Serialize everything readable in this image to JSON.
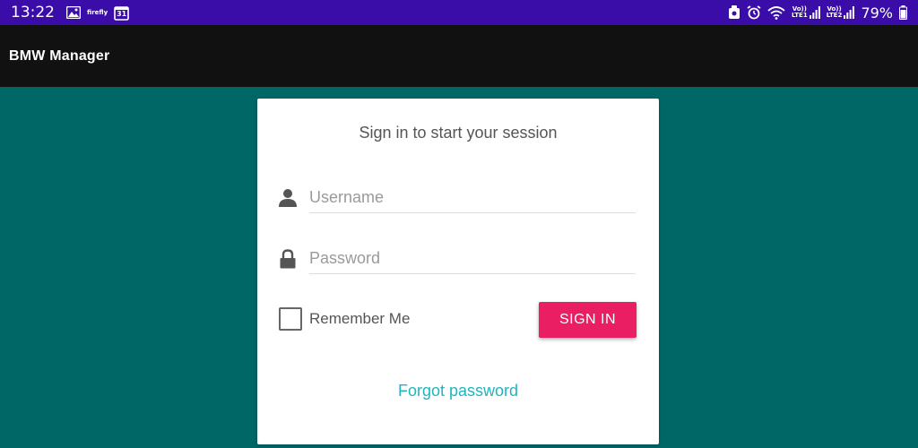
{
  "status_bar": {
    "time": "13:22",
    "left_icons": [
      "image-icon",
      "firefly-icon",
      "calendar-icon"
    ],
    "calendar_day": "31",
    "firefly_text": "firefly",
    "right_icons": [
      "notification-icon",
      "alarm-icon",
      "wifi-icon",
      "lte1-signal-icon",
      "lte2-signal-icon",
      "battery-icon"
    ],
    "lte1_label": "LTE1",
    "lte2_label": "LTE2",
    "volte_label": "Vo))",
    "battery": "79%"
  },
  "app_bar": {
    "title": "BMW Manager"
  },
  "login": {
    "title": "Sign in to start your session",
    "username_placeholder": "Username",
    "username_value": "",
    "username_icon": "user-icon",
    "password_placeholder": "Password",
    "password_value": "",
    "password_icon": "lock-icon",
    "remember_label": "Remember Me",
    "remember_checked": false,
    "signin_label": "SIGN IN",
    "forgot_label": "Forgot password"
  },
  "colors": {
    "status_bar": "#3a0ca8",
    "app_bar": "#111111",
    "background": "#006666",
    "accent_button": "#e91e63",
    "link": "#1fb5bf"
  }
}
